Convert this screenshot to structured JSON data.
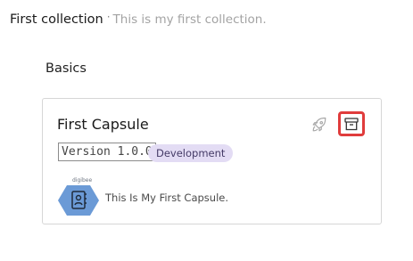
{
  "collection": {
    "title": "First collection",
    "separator": "·",
    "description": "This is my first collection."
  },
  "section": {
    "title": "Basics"
  },
  "capsule": {
    "title": "First Capsule",
    "version": "Version 1.0.0",
    "environment": "Development",
    "description": "This Is My First Capsule.",
    "logo_text": "digibee"
  },
  "actions": {
    "deploy_icon": "rocket-icon",
    "archive_icon": "archive-icon"
  },
  "colors": {
    "highlight": "#e03c3c",
    "badge_bg": "#e3dcf4",
    "logo_hex": "#6b9ad6"
  }
}
